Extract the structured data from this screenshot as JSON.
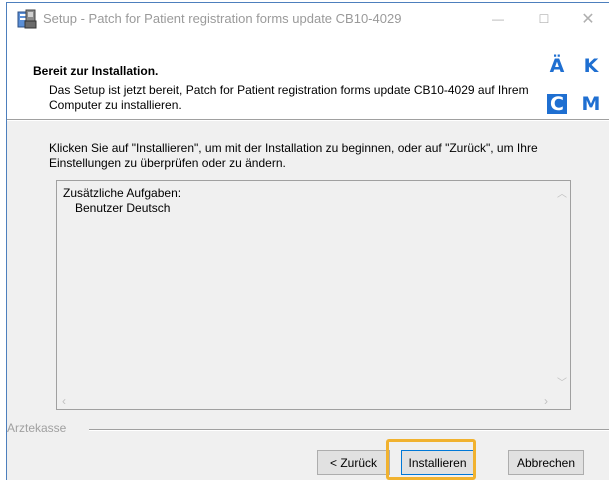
{
  "window": {
    "title": "Setup - Patch for Patient registration forms update CB10-4029",
    "min_symbol": "—",
    "max_symbol": "☐",
    "close_symbol": "✕"
  },
  "header": {
    "title": "Bereit zur Installation.",
    "description": "Das Setup ist jetzt bereit, Patch for Patient registration forms update CB10-4029 auf Ihrem Computer zu installieren.",
    "logo_letters": [
      "Ä",
      "K",
      "C",
      "M"
    ]
  },
  "body": {
    "instruction": "Klicken Sie auf \"Installieren\", um mit der Installation zu beginnen, oder auf \"Zurück\", um Ihre Einstellungen zu überprüfen oder zu ändern.",
    "memo_line1": "Zusätzliche Aufgaben:",
    "memo_line2": "Benutzer Deutsch"
  },
  "footer": {
    "brand_label": "Arztekasse"
  },
  "buttons": {
    "back": "< Zurück",
    "install": "Installieren",
    "cancel": "Abbrechen"
  },
  "colors": {
    "accent": "#1f6fd1",
    "highlight": "#f1b22f",
    "window_border": "#4d7fbd"
  }
}
